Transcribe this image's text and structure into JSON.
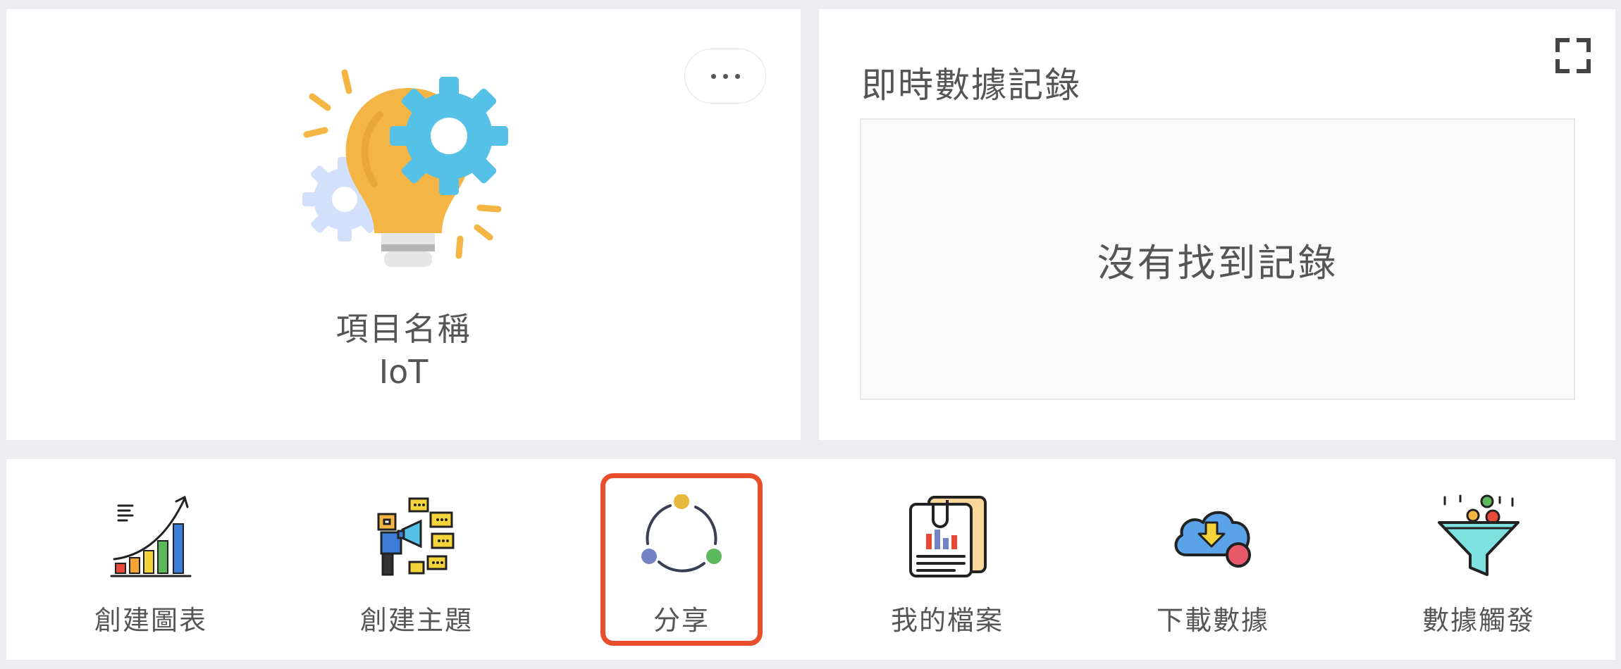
{
  "project": {
    "label": "項目名稱",
    "name": "IoT",
    "icon": "lightbulb-gears-icon",
    "more_icon": "more-horizontal-icon"
  },
  "records": {
    "title": "即時數據記錄",
    "empty_text": "沒有找到記錄",
    "expand_icon": "fullscreen-expand-icon"
  },
  "actions": [
    {
      "label": "創建圖表",
      "icon": "growth-chart-icon"
    },
    {
      "label": "創建主題",
      "icon": "broadcast-topic-icon"
    },
    {
      "label": "分享",
      "icon": "share-cycle-icon",
      "selected": true
    },
    {
      "label": "我的檔案",
      "icon": "document-report-icon"
    },
    {
      "label": "下載數據",
      "icon": "cloud-download-icon"
    },
    {
      "label": "數據觸發",
      "icon": "funnel-trigger-icon"
    }
  ],
  "colors": {
    "background": "#ececf1",
    "card": "#ffffff",
    "selected_border": "#e94e2c",
    "text": "#555555"
  }
}
